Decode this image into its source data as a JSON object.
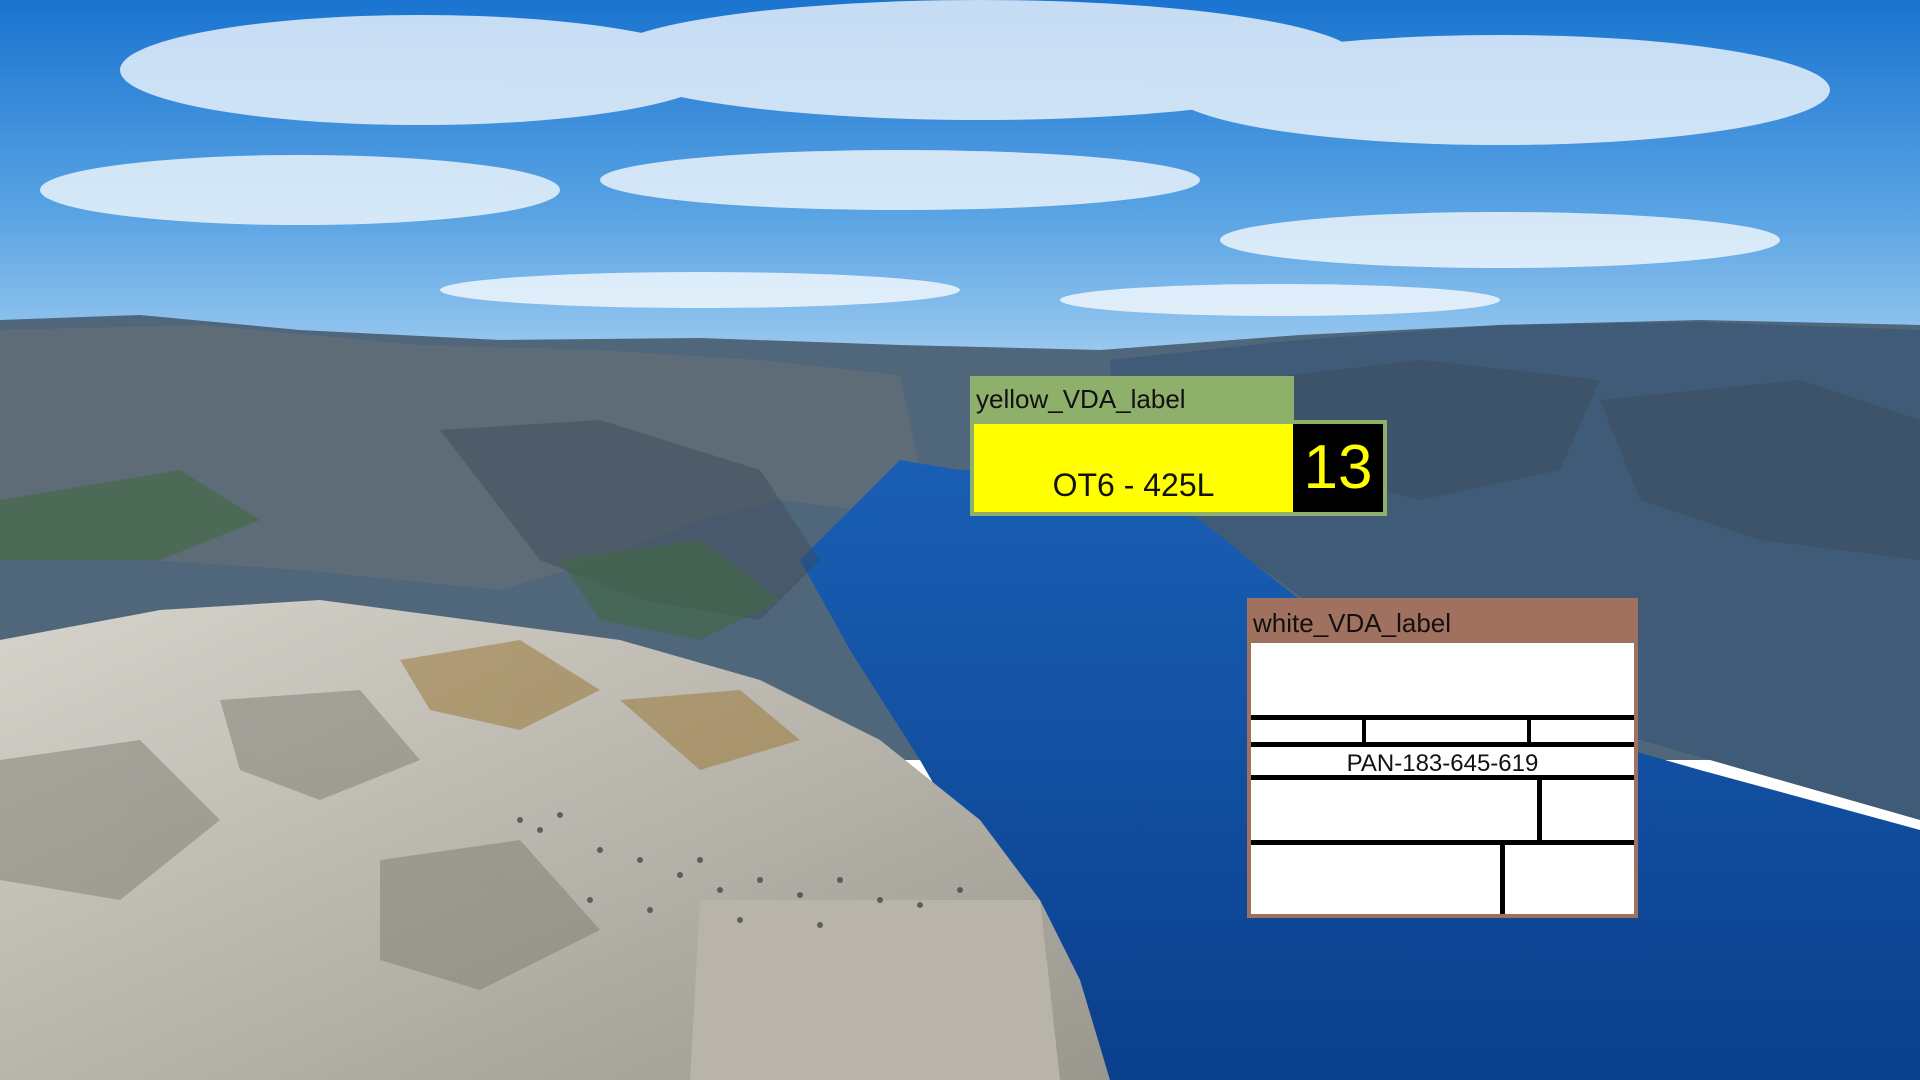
{
  "scene": {
    "description_icon": "fjord-cliff-landscape",
    "colors": {
      "sky_top": "#1f7ed6",
      "sky_bottom": "#7fb8e6",
      "water": "#0b4fa8",
      "mountain": "#4f6578",
      "rock": "#c9c6bc"
    }
  },
  "labels": {
    "yellow": {
      "title": "yellow_VDA_label",
      "text": "OT6 - 425L",
      "number": "13",
      "colors": {
        "frame": "#8fb06a",
        "fill": "#ffff00",
        "badge": "#000000",
        "badge_text": "#ffff00"
      }
    },
    "white": {
      "title": "white_VDA_label",
      "code": "PAN-183-645-619",
      "colors": {
        "frame": "#a0715e",
        "fill": "#ffffff"
      }
    }
  }
}
